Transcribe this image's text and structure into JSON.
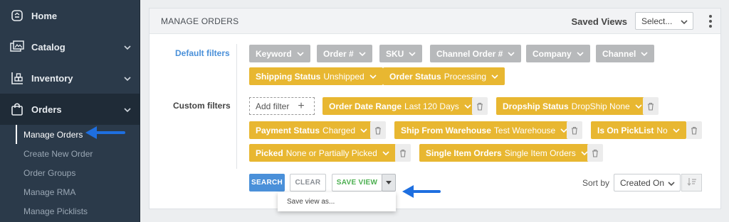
{
  "sidebar": {
    "items": [
      {
        "label": "Home",
        "icon": "home-icon",
        "chevron": false
      },
      {
        "label": "Catalog",
        "icon": "catalog-icon",
        "chevron": true
      },
      {
        "label": "Inventory",
        "icon": "inventory-icon",
        "chevron": true
      },
      {
        "label": "Orders",
        "icon": "orders-icon",
        "chevron": true
      }
    ],
    "sub_items": [
      "Manage Orders",
      "Create New Order",
      "Order Groups",
      "Manage RMA",
      "Manage Picklists"
    ]
  },
  "header": {
    "title": "MANAGE ORDERS",
    "saved_views_label": "Saved Views",
    "saved_views_value": "Select..."
  },
  "filters": {
    "default_label": "Default filters",
    "custom_label": "Custom filters",
    "default_chips": [
      "Keyword",
      "Order #",
      "SKU",
      "Channel Order #",
      "Company",
      "Channel"
    ],
    "status_chips": [
      {
        "key": "Shipping Status",
        "value": "Unshipped"
      },
      {
        "key": "Order Status",
        "value": "Processing"
      }
    ],
    "add_filter_label": "Add filter",
    "custom_chips": [
      {
        "key": "Order Date Range",
        "value": "Last 120 Days"
      },
      {
        "key": "Dropship Status",
        "value": "DropShip None"
      },
      {
        "key": "Payment Status",
        "value": "Charged"
      },
      {
        "key": "Ship From Warehouse",
        "value": "Test Warehouse"
      },
      {
        "key": "Is On PickList",
        "value": "No"
      },
      {
        "key": "Picked",
        "value": "None or Partially Picked"
      },
      {
        "key": "Single Item Orders",
        "value": "Single Item Orders"
      }
    ]
  },
  "actions": {
    "search": "SEARCH",
    "clear": "CLEAR",
    "save_view": "SAVE VIEW",
    "save_view_as": "Save view as...",
    "sort_by_label": "Sort by",
    "sort_by_value": "Created On"
  },
  "colors": {
    "sidebar_bg": "#2b3a4a",
    "chip_gold": "#e8b731",
    "chip_gray": "#b7b9bb",
    "link_blue": "#4a90d9",
    "save_green": "#4caf50",
    "arrow_blue": "#1e6fe0"
  }
}
